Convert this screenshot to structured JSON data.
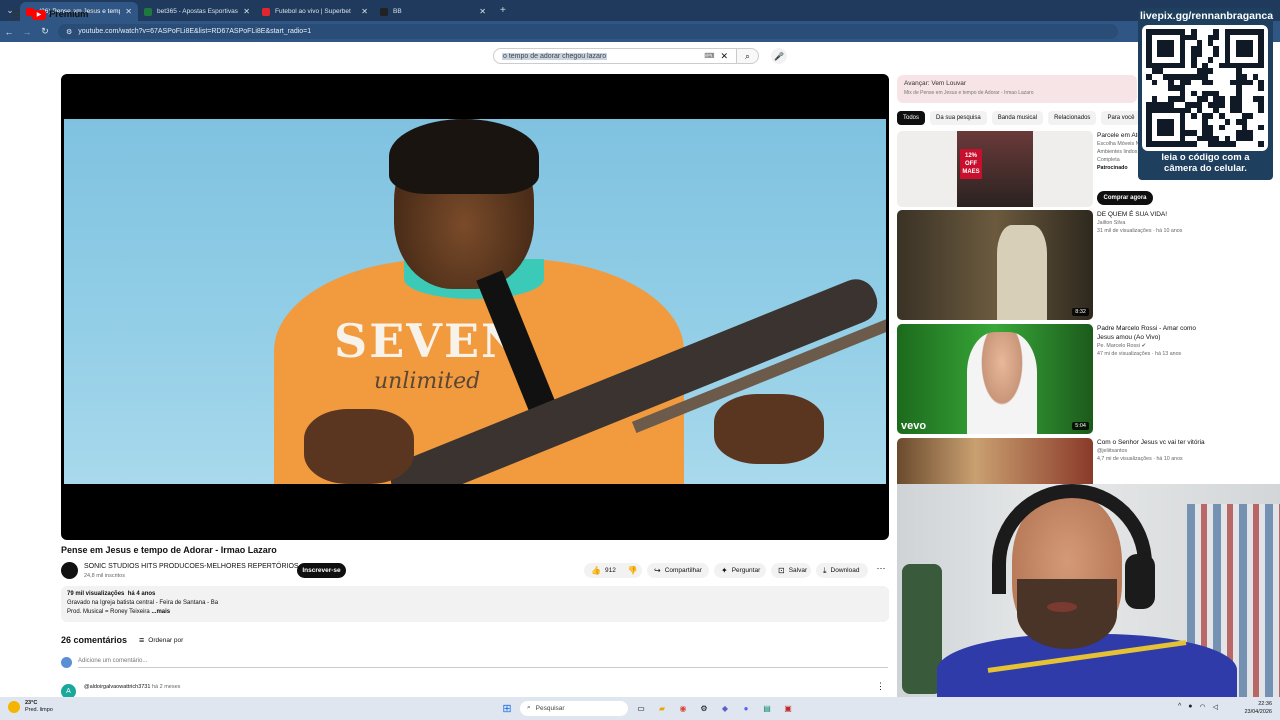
{
  "browser": {
    "tabs": [
      {
        "title": "(36) Pense em Jesus e tempo d",
        "favicon_color": "#ff0000"
      },
      {
        "title": "bet365 - Apostas Esportivas On",
        "favicon_color": "#1d7a3c"
      },
      {
        "title": "Futebol ao vivo | Superbet",
        "favicon_color": "#e3262d"
      },
      {
        "title": "BB",
        "favicon_color": "#222222"
      }
    ],
    "url": "youtube.com/watch?v=67ASPoFLi8E&list=RD67ASPoFLi8E&start_radio=1"
  },
  "youtube": {
    "logo_text": "Premium",
    "logo_badge": "BR",
    "search_query": "o tempo de adorar chegou lazaro"
  },
  "video": {
    "title": "Pense em Jesus e tempo de Adorar - Irmao Lazaro",
    "shirt_text_1": "SEVEN",
    "shirt_text_2": "unlimited",
    "channel": "SONIC STUDIOS HITS PRODUCOES-MELHORES REPERTÓRIOS",
    "subscribers": "24,8 mil inscritos",
    "subscribe_label": "Inscrever-se",
    "likes": "912",
    "share_label": "Compartilhar",
    "ask_label": "Perguntar",
    "save_label": "Salvar",
    "download_label": "Download",
    "views": "79 mil visualizações",
    "age": "há 4 anos",
    "desc_line1": "Gravado na Igreja batista central - Feira de Santana - Ba",
    "desc_line2": "Prod. Musical = Roney Teixeira ",
    "desc_more": "...mais"
  },
  "comments": {
    "count": "26 comentários",
    "sort_label": "Ordenar por",
    "add_placeholder": "Adicione um comentário...",
    "first_avatar": "A",
    "first_author": "@aldoirgalvaowattrich3731",
    "first_age": "há 2 meses"
  },
  "sidebar": {
    "next_label": "Avançar: Vem Louvar",
    "mix_label": "Mix de Pense em Jesus e tempo de Adorar - Irmao Lazaro",
    "chips": [
      "Todos",
      "Da sua pesquisa",
      "Banda musical",
      "Relacionados",
      "Para você"
    ],
    "ad": {
      "title": "Parcele em Até",
      "line2": "Escolha Móveis N",
      "line3": "Ambientes lindos",
      "line4": "Completa",
      "sponsored": "Patrocinado",
      "button": "Comprar agora",
      "badge_pct": "12%",
      "badge_off": "OFF",
      "badge_tag": "MAES"
    },
    "videos": [
      {
        "title": "DE QUEM É SUA VIDA!",
        "channel": "Jailton Silva",
        "meta": "31 mil de visualizações · há 10 anos",
        "duration": "8:32"
      },
      {
        "title": "Padre Marcelo Rossi - Amar como Jesus amou (Ao Vivo)",
        "channel": "Pe. Marcelo Rossi",
        "meta": "47 mi de visualizações · há 13 anos",
        "duration": "5:04",
        "overlay": "vevo"
      },
      {
        "title": "Com o Senhor Jesus vc vai ter vitória",
        "channel": "@jeliitsantos",
        "meta": "4,7 mi de visualizações · há 10 anos",
        "duration": ""
      }
    ]
  },
  "overlay": {
    "qr_title": "livepix.gg/rennanbraganca",
    "qr_caption_1": "leia o código com a",
    "qr_caption_2": "câmera do celular."
  },
  "taskbar": {
    "temp": "23°C",
    "weather": "Pred. limpo",
    "search_label": "Pesquisar",
    "time": "22:36",
    "date": "23/04/2026"
  }
}
